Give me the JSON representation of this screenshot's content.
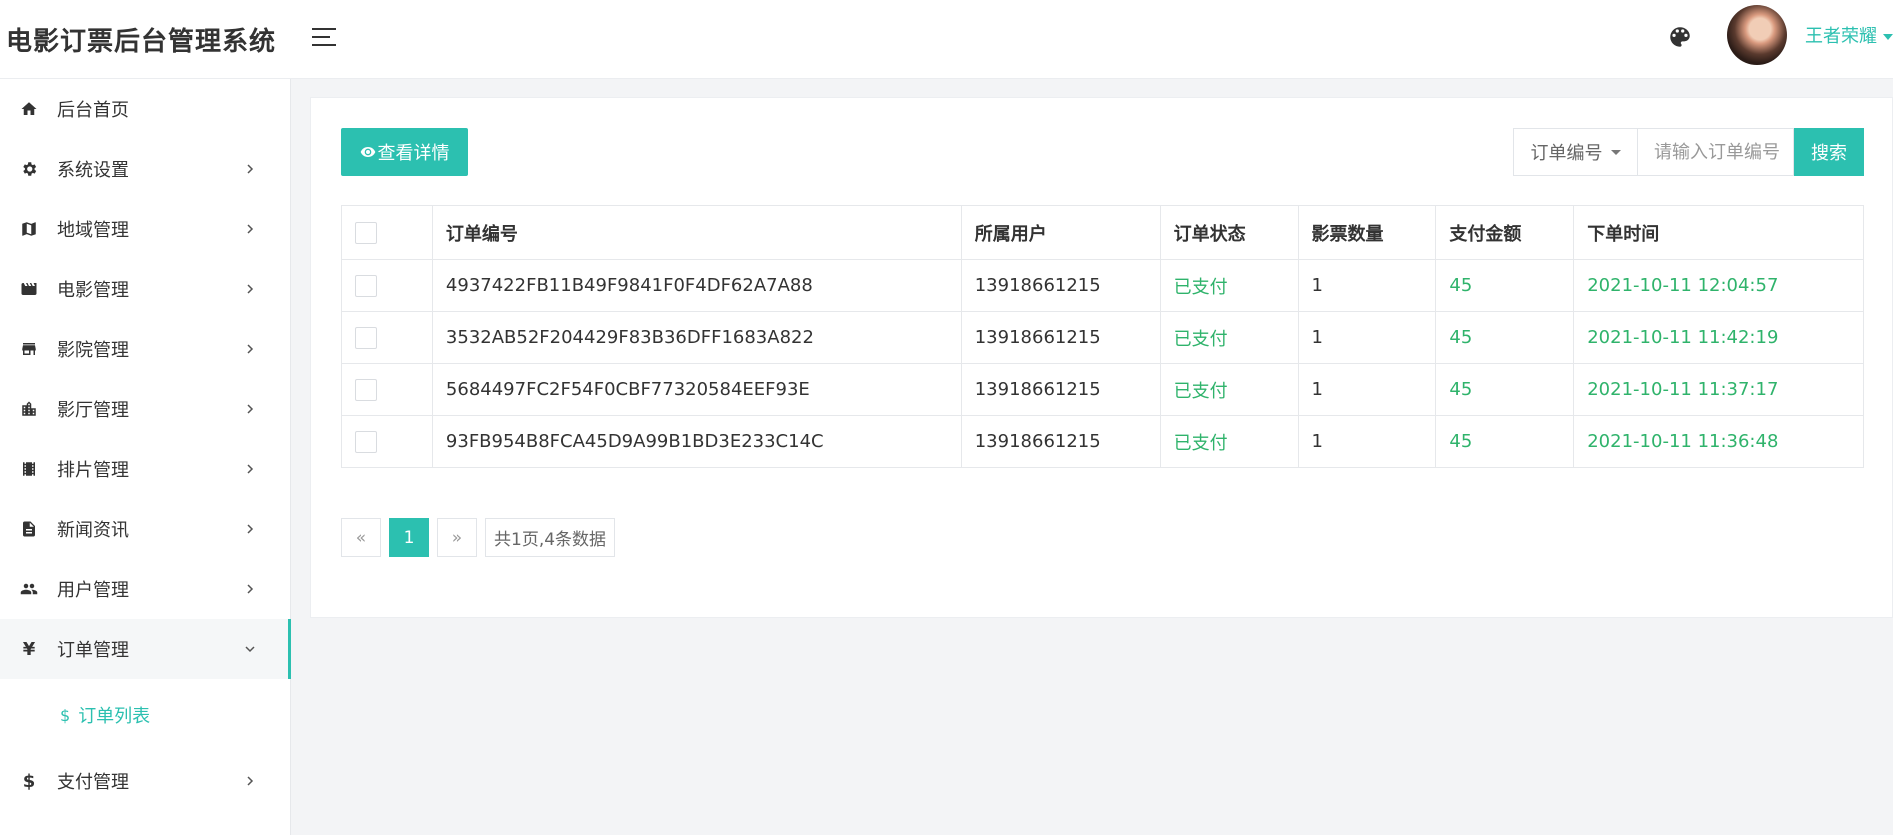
{
  "header": {
    "brand": "电影订票后台管理系统",
    "menu_icon": "hamburger-menu-icon",
    "theme_icon": "palette-icon",
    "username": "王者荣耀"
  },
  "sidebar": {
    "items": [
      {
        "label": "后台首页",
        "icon": "home-icon",
        "arrow": false
      },
      {
        "label": "系统设置",
        "icon": "gear-icon",
        "arrow": true
      },
      {
        "label": "地域管理",
        "icon": "map-icon",
        "arrow": true
      },
      {
        "label": "电影管理",
        "icon": "film-icon",
        "arrow": true
      },
      {
        "label": "影院管理",
        "icon": "store-icon",
        "arrow": true
      },
      {
        "label": "影厅管理",
        "icon": "building-icon",
        "arrow": true
      },
      {
        "label": "排片管理",
        "icon": "film-strip-icon",
        "arrow": true
      },
      {
        "label": "新闻资讯",
        "icon": "document-icon",
        "arrow": true
      },
      {
        "label": "用户管理",
        "icon": "users-icon",
        "arrow": true
      },
      {
        "label": "订单管理",
        "icon": "yen-icon",
        "arrow": true,
        "expanded": true
      },
      {
        "label": "支付管理",
        "icon": "dollar-icon",
        "arrow": true
      }
    ],
    "sub_item": {
      "label": "订单列表",
      "prefix": "$"
    }
  },
  "toolbar": {
    "detail_button": "查看详情",
    "search_field_select": "订单编号",
    "search_placeholder": "请输入订单编号",
    "search_button": "搜索"
  },
  "table": {
    "columns": [
      "订单编号",
      "所属用户",
      "订单状态",
      "影票数量",
      "支付金额",
      "下单时间"
    ],
    "rows": [
      {
        "order_no": "4937422FB11B49F9841F0F4DF62A7A88",
        "user": "13918661215",
        "status": "已支付",
        "qty": "1",
        "amount": "45",
        "time": "2021-10-11 12:04:57"
      },
      {
        "order_no": "3532AB52F204429F83B36DFF1683A822",
        "user": "13918661215",
        "status": "已支付",
        "qty": "1",
        "amount": "45",
        "time": "2021-10-11 11:42:19"
      },
      {
        "order_no": "5684497FC2F54F0CBF77320584EEF93E",
        "user": "13918661215",
        "status": "已支付",
        "qty": "1",
        "amount": "45",
        "time": "2021-10-11 11:37:17"
      },
      {
        "order_no": "93FB954B8FCA45D9A99B1BD3E233C14C",
        "user": "13918661215",
        "status": "已支付",
        "qty": "1",
        "amount": "45",
        "time": "2021-10-11 11:36:48"
      }
    ]
  },
  "pagination": {
    "prev": "«",
    "current": "1",
    "next": "»",
    "summary": "共1页,4条数据"
  },
  "colors": {
    "accent": "#2cc0b0",
    "status_green": "#2fb36b"
  }
}
